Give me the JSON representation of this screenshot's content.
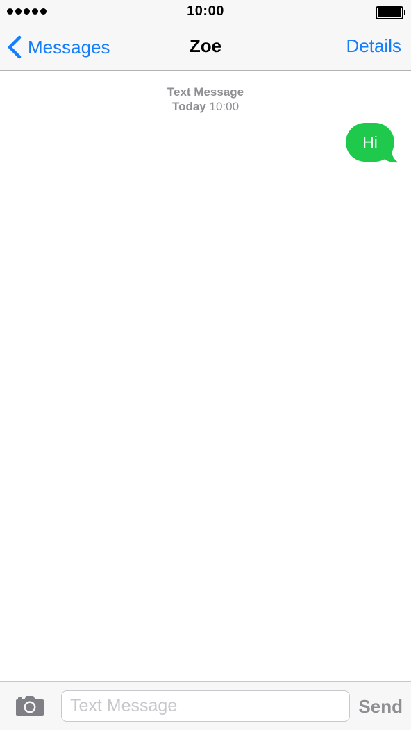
{
  "status_bar": {
    "time": "10:00",
    "icons": {
      "signal": "signal-dots-icon",
      "battery": "battery-full-icon"
    }
  },
  "nav": {
    "back_label": "Messages",
    "back_icon": "chevron-left-icon",
    "title": "Zoe",
    "details_label": "Details"
  },
  "thread": {
    "header_type": "Text Message",
    "header_day": "Today",
    "header_time": "10:00",
    "messages": [
      {
        "direction": "outgoing",
        "text": "Hi"
      }
    ]
  },
  "input_bar": {
    "camera_icon": "camera-icon",
    "placeholder": "Text Message",
    "value": "",
    "send_label": "Send"
  },
  "colors": {
    "accent": "#157efb",
    "bubble_outgoing": "#1ec94c",
    "bar_background": "#f7f7f7",
    "muted_text": "#8e8e93"
  }
}
